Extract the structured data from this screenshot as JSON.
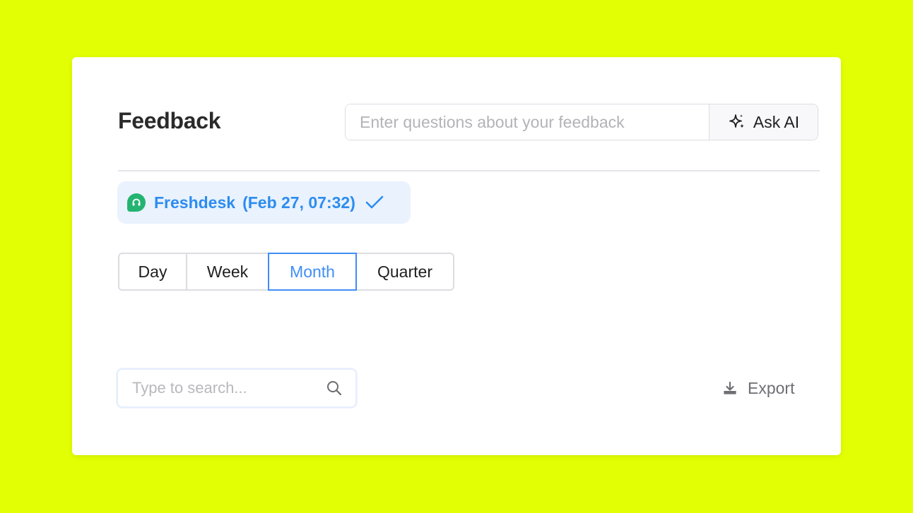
{
  "header": {
    "title": "Feedback",
    "ask_placeholder": "Enter questions about your feedback",
    "ask_button_label": "Ask AI",
    "ask_icon": "sparkle-icon"
  },
  "source": {
    "name": "Freshdesk",
    "timestamp": "(Feb 27, 07:32)",
    "logo_icon": "freshdesk-headset-icon",
    "status_icon": "check-icon"
  },
  "period_tabs": [
    {
      "label": "Day",
      "active": false
    },
    {
      "label": "Week",
      "active": false
    },
    {
      "label": "Month",
      "active": true
    },
    {
      "label": "Quarter",
      "active": false
    }
  ],
  "search": {
    "placeholder": "Type to search...",
    "icon": "search-icon"
  },
  "export": {
    "label": "Export",
    "icon": "download-icon"
  },
  "colors": {
    "background": "#e2ff03",
    "accent": "#3f8ef7",
    "source_text": "#2d8cf0",
    "freshdesk_green": "#24b472"
  }
}
